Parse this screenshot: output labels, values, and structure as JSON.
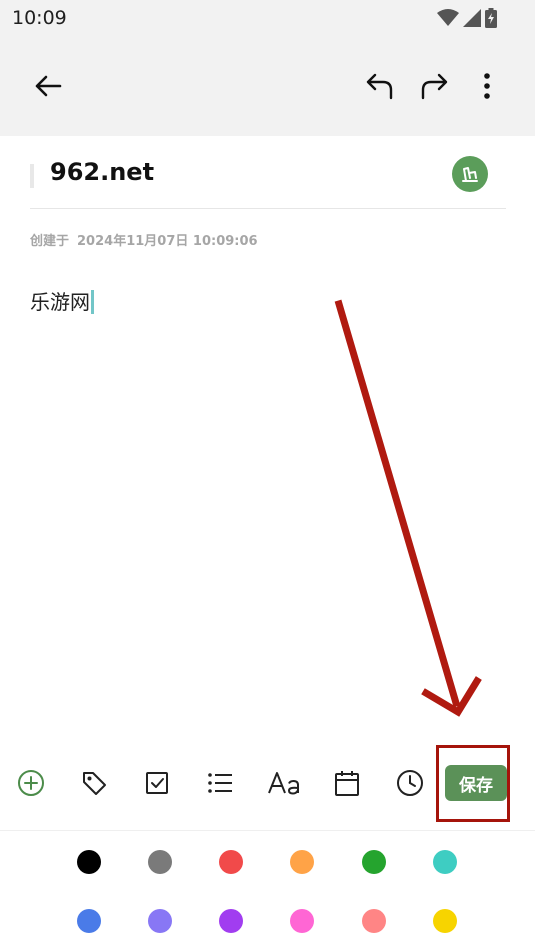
{
  "status_bar": {
    "time": "10:09",
    "icons": [
      "wifi-icon",
      "signal-icon",
      "battery-icon"
    ]
  },
  "app_bar": {
    "back_icon": "arrow-left-icon",
    "undo_icon": "undo-icon",
    "redo_icon": "redo-icon",
    "menu_icon": "more-vertical-icon"
  },
  "note": {
    "title": "962.net",
    "created_label": "创建于",
    "created_datetime": "2024年11月07日 10:09:06",
    "body": "乐游网",
    "badge_icon": "note-style-icon",
    "badge_color": "#5b9d5a"
  },
  "toolbar": {
    "items": [
      {
        "name": "add-icon",
        "color": "#4c8c4a"
      },
      {
        "name": "tag-icon"
      },
      {
        "name": "checkbox-icon"
      },
      {
        "name": "list-icon"
      },
      {
        "name": "text-format-icon"
      },
      {
        "name": "calendar-icon"
      },
      {
        "name": "clock-icon"
      }
    ],
    "save_label": "保存",
    "save_color": "#5b9158"
  },
  "palette": {
    "colors": [
      "#000000",
      "#7a7a7a",
      "#f14a4a",
      "#ffa347",
      "#25a42e",
      "#3ecdc2",
      "#4a7be8",
      "#8877f5",
      "#a13df0",
      "#ff66d4",
      "#ff8585",
      "#f7d400"
    ]
  },
  "annotation": {
    "color": "#b01a10"
  }
}
